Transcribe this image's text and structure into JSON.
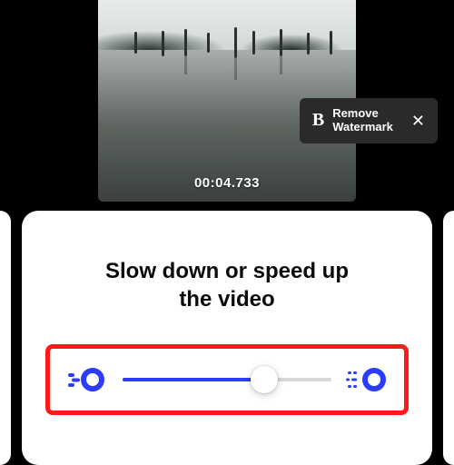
{
  "preview": {
    "timestamp": "00:04.733"
  },
  "watermark_banner": {
    "logo_text": "B",
    "line1": "Remove",
    "line2": "Watermark",
    "close_glyph": "✕"
  },
  "card": {
    "title_line1": "Slow down or speed up",
    "title_line2": "the video"
  },
  "slider": {
    "position_percent": 68
  },
  "colors": {
    "accent": "#2b3cff",
    "highlight_border": "#ff1a1a"
  }
}
